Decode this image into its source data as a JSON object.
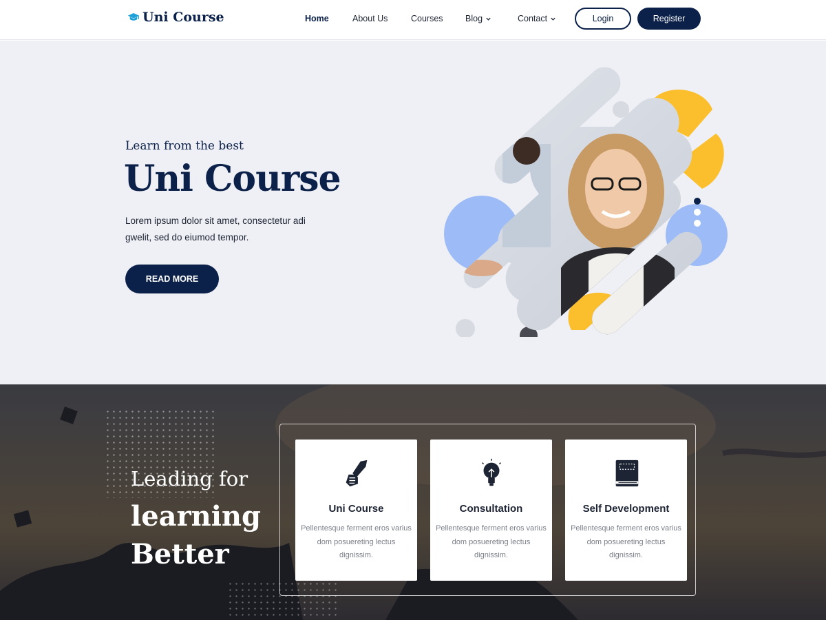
{
  "brand": {
    "name": "Uni Course",
    "accent": "#0b2149",
    "icon": "graduation-cap-icon",
    "icon_color": "#1ea0d8"
  },
  "nav": {
    "items": [
      {
        "label": "Home",
        "active": true
      },
      {
        "label": "About Us"
      },
      {
        "label": "Courses"
      },
      {
        "label": "Blog",
        "dropdown": true
      },
      {
        "label": "Contact",
        "dropdown": true
      }
    ],
    "login_label": "Login",
    "register_label": "Register"
  },
  "hero": {
    "kicker": "Learn from the best",
    "title": "Uni Course",
    "description": "Lorem ipsum dolor sit amet, consectetur adi gwelit, sed do eiumod tempor.",
    "button_label": "READ MORE",
    "slider_dots": 3,
    "active_dot": 1
  },
  "features": {
    "heading_line1": "Leading for",
    "heading_line2": "learning",
    "heading_line3": "Better",
    "cards": [
      {
        "icon": "pen-hand-icon",
        "title": "Uni Course",
        "text": "Pellentesque ferment eros varius dom posuereting lectus dignissim."
      },
      {
        "icon": "lightbulb-icon",
        "title": "Consultation",
        "text": "Pellentesque ferment eros varius dom posuereting lectus dignissim."
      },
      {
        "icon": "book-icon",
        "title": "Self Development",
        "text": "Pellentesque ferment eros varius dom posuereting lectus dignissim."
      }
    ]
  },
  "colors": {
    "hero_bg": "#eff0f5",
    "yellow": "#fbbf2e",
    "blue": "#9dbcf7",
    "dark": "#0b2149"
  }
}
